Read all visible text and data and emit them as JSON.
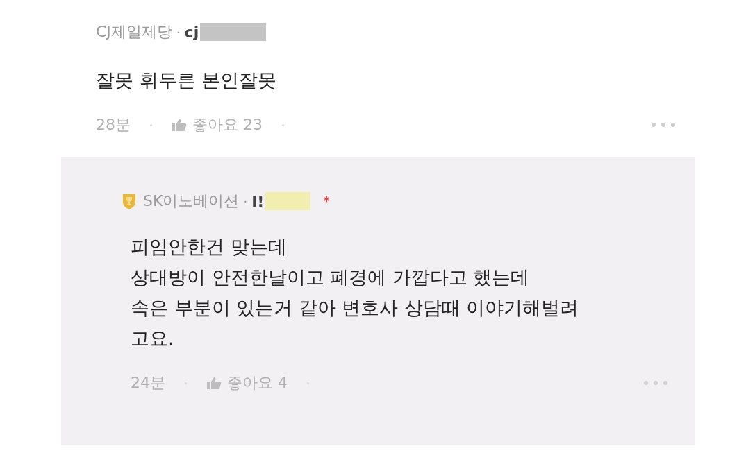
{
  "comments": [
    {
      "company": "CJ제일제당",
      "separator": "·",
      "handle": "cj",
      "badge": false,
      "new_mark": false,
      "redaction": {
        "color": "#c4c4c4"
      },
      "lines": [
        "잘못 휘두른 본인잘못"
      ],
      "time": "28분",
      "likes": "좋아요 23",
      "reply": false
    },
    {
      "company": "SK이노베이션",
      "separator": "·",
      "handle": "I!",
      "badge": true,
      "new_mark": true,
      "redaction": {
        "color": "#f2eeb0"
      },
      "lines": [
        "피임안한건 맞는데",
        "상대방이 안전한날이고 폐경에 가깝다고 했는데",
        "속은 부분이 있는거 같아 변호사 상담때 이야기해벌려",
        "고요."
      ],
      "time": "24분",
      "likes": "좋아요 4",
      "reply": true
    }
  ]
}
